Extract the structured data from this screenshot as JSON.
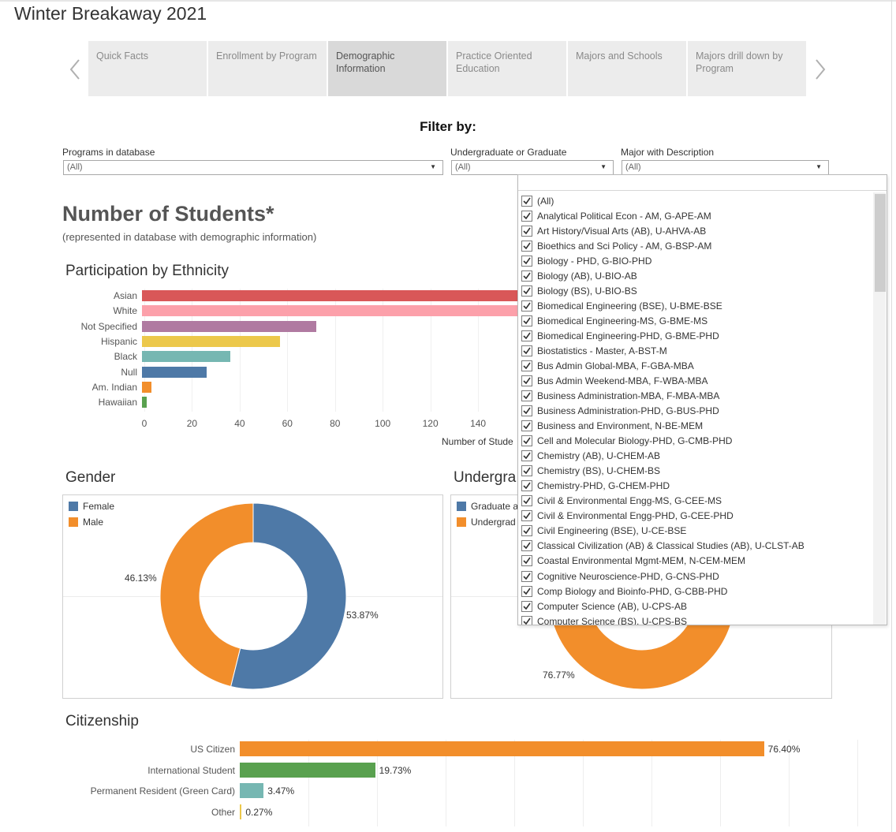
{
  "page": {
    "title": "Winter Breakaway 2021"
  },
  "nav": {
    "tabs": [
      {
        "label": "Quick Facts"
      },
      {
        "label": "Enrollment by Program"
      },
      {
        "label": "Demographic Information"
      },
      {
        "label": "Practice Oriented Education"
      },
      {
        "label": "Majors and Schools"
      },
      {
        "label": "Majors drill down by Program"
      }
    ],
    "active_tab": "Demographic Information",
    "prev_icon": "chevron-left-icon",
    "next_icon": "chevron-right-icon"
  },
  "filters": {
    "heading": "Filter by:",
    "programs": {
      "label": "Programs in database",
      "value": "(All)"
    },
    "level": {
      "label": "Undergraduate or Graduate",
      "value": "(All)"
    },
    "major": {
      "label": "Major with Description",
      "value": "(All)"
    }
  },
  "header": {
    "title": "Number of Students*",
    "subtitle": "(represented in database with demographic information)"
  },
  "ethnicity": {
    "title": "Participation by Ethnicity",
    "axis_title": "Number of Stude",
    "chart_data": {
      "type": "bar",
      "orientation": "horizontal",
      "categories": [
        "Asian",
        "White",
        "Not Specified",
        "Hispanic",
        "Black",
        "Null",
        "Am. Indian",
        "Hawaiian"
      ],
      "values": [
        null,
        null,
        73,
        58,
        37,
        27,
        4,
        2
      ],
      "note_values_truncated": "Asian and White bars extend beyond the visible area",
      "colors": [
        "#d95758",
        "#fca0aa",
        "#b07aa1",
        "#ecc84b",
        "#76b7b2",
        "#4e79a7",
        "#f28e2b",
        "#59a14f"
      ],
      "x_ticks": [
        "0",
        "20",
        "40",
        "60",
        "80",
        "100",
        "120",
        "140"
      ],
      "xlim": [
        0,
        140
      ]
    }
  },
  "gender": {
    "title": "Gender",
    "chart_data": {
      "type": "pie",
      "donut": true,
      "categories": [
        "Female",
        "Male"
      ],
      "values": [
        53.87,
        46.13
      ],
      "labels": [
        "53.87%",
        "46.13%"
      ],
      "colors": [
        "#4e79a7",
        "#f28e2b"
      ],
      "legend_position": "top-left"
    }
  },
  "level_chart": {
    "title": "Undergra",
    "chart_data": {
      "type": "pie",
      "donut": true,
      "legend_entries": [
        "Graduate a",
        "Undergrad"
      ],
      "colors": [
        "#4e79a7",
        "#f28e2b"
      ],
      "values": [
        23.23,
        76.77
      ],
      "labels": [
        "76.77%"
      ]
    }
  },
  "citizenship": {
    "title": "Citizenship",
    "chart_data": {
      "type": "bar",
      "orientation": "horizontal",
      "categories": [
        "US Citizen",
        "International Student",
        "Permanent Resident (Green Card)",
        "Other"
      ],
      "values": [
        76.4,
        19.73,
        3.47,
        0.27
      ],
      "labels": [
        "76.40%",
        "19.73%",
        "3.47%",
        "0.27%"
      ],
      "colors": [
        "#f28e2b",
        "#59a14f",
        "#76b7b2",
        "#ecc84b"
      ]
    }
  },
  "major_dropdown": {
    "items": [
      "(All)",
      "Analytical Political Econ - AM, G-APE-AM",
      "Art History/Visual Arts (AB), U-AHVA-AB",
      "Bioethics and Sci Policy - AM, G-BSP-AM",
      "Biology - PHD, G-BIO-PHD",
      "Biology (AB), U-BIO-AB",
      "Biology (BS), U-BIO-BS",
      "Biomedical Engineering (BSE), U-BME-BSE",
      "Biomedical Engineering-MS, G-BME-MS",
      "Biomedical Engineering-PHD, G-BME-PHD",
      "Biostatistics - Master, A-BST-M",
      "Bus Admin Global-MBA, F-GBA-MBA",
      "Bus Admin Weekend-MBA, F-WBA-MBA",
      "Business Administration-MBA, F-MBA-MBA",
      "Business Administration-PHD, G-BUS-PHD",
      "Business and Environment, N-BE-MEM",
      "Cell and Molecular Biology-PHD, G-CMB-PHD",
      "Chemistry (AB), U-CHEM-AB",
      "Chemistry (BS), U-CHEM-BS",
      "Chemistry-PHD, G-CHEM-PHD",
      "Civil & Environmental Engg-MS, G-CEE-MS",
      "Civil & Environmental Engg-PHD, G-CEE-PHD",
      "Civil Engineering (BSE), U-CE-BSE",
      "Classical Civilization (AB) & Classical Studies (AB), U-CLST-AB",
      "Coastal Environmental Mgmt-MEM, N-CEM-MEM",
      "Cognitive Neuroscience-PHD, G-CNS-PHD",
      "Comp Biology and Bioinfo-PHD, G-CBB-PHD",
      "Computer Science (AB), U-CPS-AB",
      "Computer Science (BS), U-CPS-BS"
    ],
    "checked": true,
    "check_icon": "checkmark-icon"
  }
}
